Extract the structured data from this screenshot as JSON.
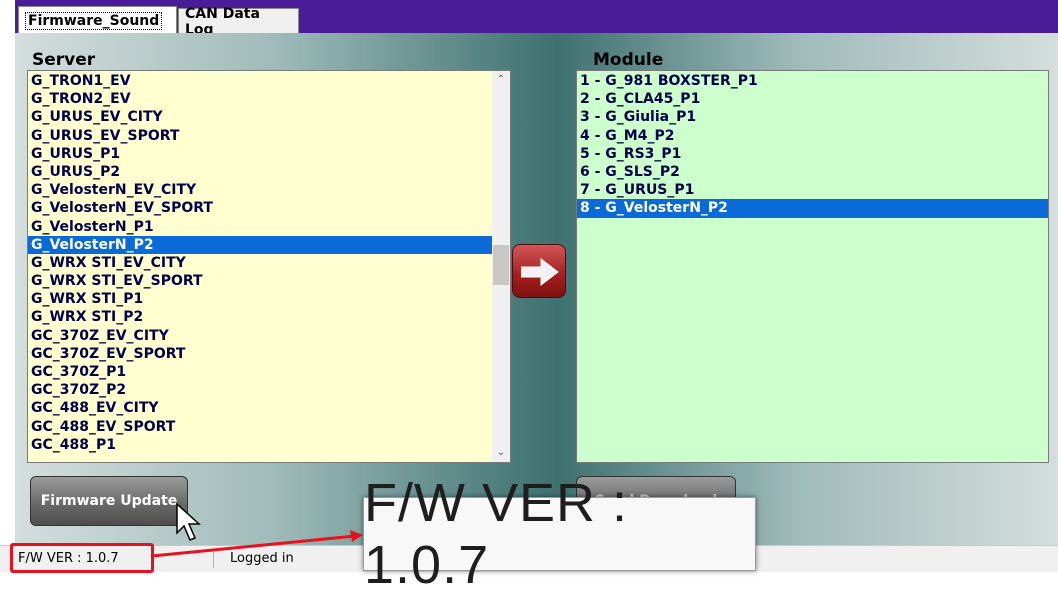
{
  "tabs": [
    {
      "label": "Firmware_Sound",
      "active": true
    },
    {
      "label": "CAN Data Log",
      "active": false
    }
  ],
  "server": {
    "heading": "Server",
    "items": [
      "G_TRON1_EV",
      "G_TRON2_EV",
      "G_URUS_EV_CITY",
      "G_URUS_EV_SPORT",
      "G_URUS_P1",
      "G_URUS_P2",
      "G_VelosterN_EV_CITY",
      "G_VelosterN_EV_SPORT",
      "G_VelosterN_P1",
      "G_VelosterN_P2",
      "G_WRX STI_EV_CITY",
      "G_WRX STI_EV_SPORT",
      "G_WRX STI_P1",
      "G_WRX STI_P2",
      "GC_370Z_EV_CITY",
      "GC_370Z_EV_SPORT",
      "GC_370Z_P1",
      "GC_370Z_P2",
      "GC_488_EV_CITY",
      "GC_488_EV_SPORT",
      "GC_488_P1"
    ],
    "selected_index": 9
  },
  "module": {
    "heading": "Module",
    "items": [
      "1 - G_981 BOXSTER_P1",
      "2 - G_CLA45_P1",
      "3 - G_Giulia_P1",
      "4 - G_M4_P2",
      "5 - G_RS3_P1",
      "6 - G_SLS_P2",
      "7 - G_URUS_P1",
      "8 - G_VelosterN_P2"
    ],
    "selected_index": 7
  },
  "buttons": {
    "firmware_update": "Firmware Update",
    "send_download": "Send Download",
    "transfer_icon": "right-arrow-icon"
  },
  "status": {
    "version": "F/W VER : 1.0.7",
    "login": "Logged in"
  },
  "zoom_callout": {
    "text": "F/W VER : 1.0.7"
  },
  "colors": {
    "tab_bar": "#4b1c97",
    "server_bg": "#ffffcf",
    "module_bg": "#ccffcc",
    "selection": "#0a6ad8",
    "highlight": "#e8121f"
  }
}
